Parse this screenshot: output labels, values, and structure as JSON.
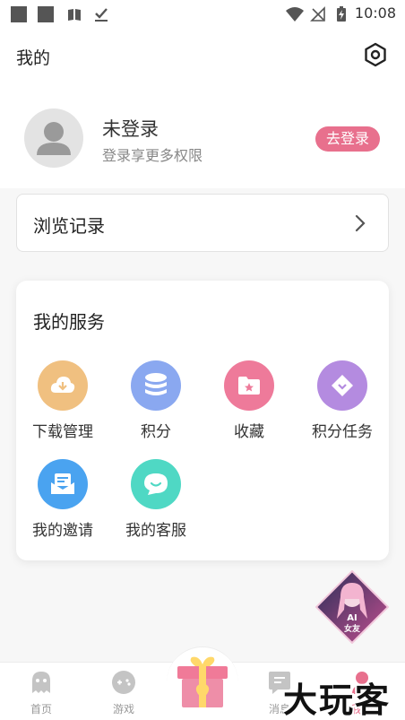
{
  "status_bar": {
    "time": "10:08"
  },
  "header": {
    "title": "我的",
    "settings_icon": "hexagon-settings-icon"
  },
  "profile": {
    "name": "未登录",
    "subtitle": "登录享更多权限",
    "login_button": "去登录",
    "accent": "#e8708d"
  },
  "history": {
    "label": "浏览记录"
  },
  "services": {
    "title": "我的服务",
    "items": [
      {
        "label": "下载管理",
        "icon": "download-cloud-icon",
        "color": "#f0c080"
      },
      {
        "label": "积分",
        "icon": "coin-stack-icon",
        "color": "#8aa8f0"
      },
      {
        "label": "收藏",
        "icon": "star-folder-icon",
        "color": "#ee7a9a"
      },
      {
        "label": "积分任务",
        "icon": "diamond-tag-icon",
        "color": "#b48be0"
      },
      {
        "label": "我的邀请",
        "icon": "invite-envelope-icon",
        "color": "#4aa3f0"
      },
      {
        "label": "我的客服",
        "icon": "chat-bubble-icon",
        "color": "#4fd8c4"
      }
    ]
  },
  "ai_badge": {
    "line1": "AI",
    "line2": "女友"
  },
  "bottom_nav": {
    "items": [
      {
        "label": "首页",
        "icon": "ghost-icon"
      },
      {
        "label": "游戏",
        "icon": "gamepad-icon"
      },
      {
        "label": "消息",
        "icon": "message-icon"
      },
      {
        "label": "我的",
        "icon": "profile-icon"
      }
    ]
  },
  "watermark": "大玩客"
}
